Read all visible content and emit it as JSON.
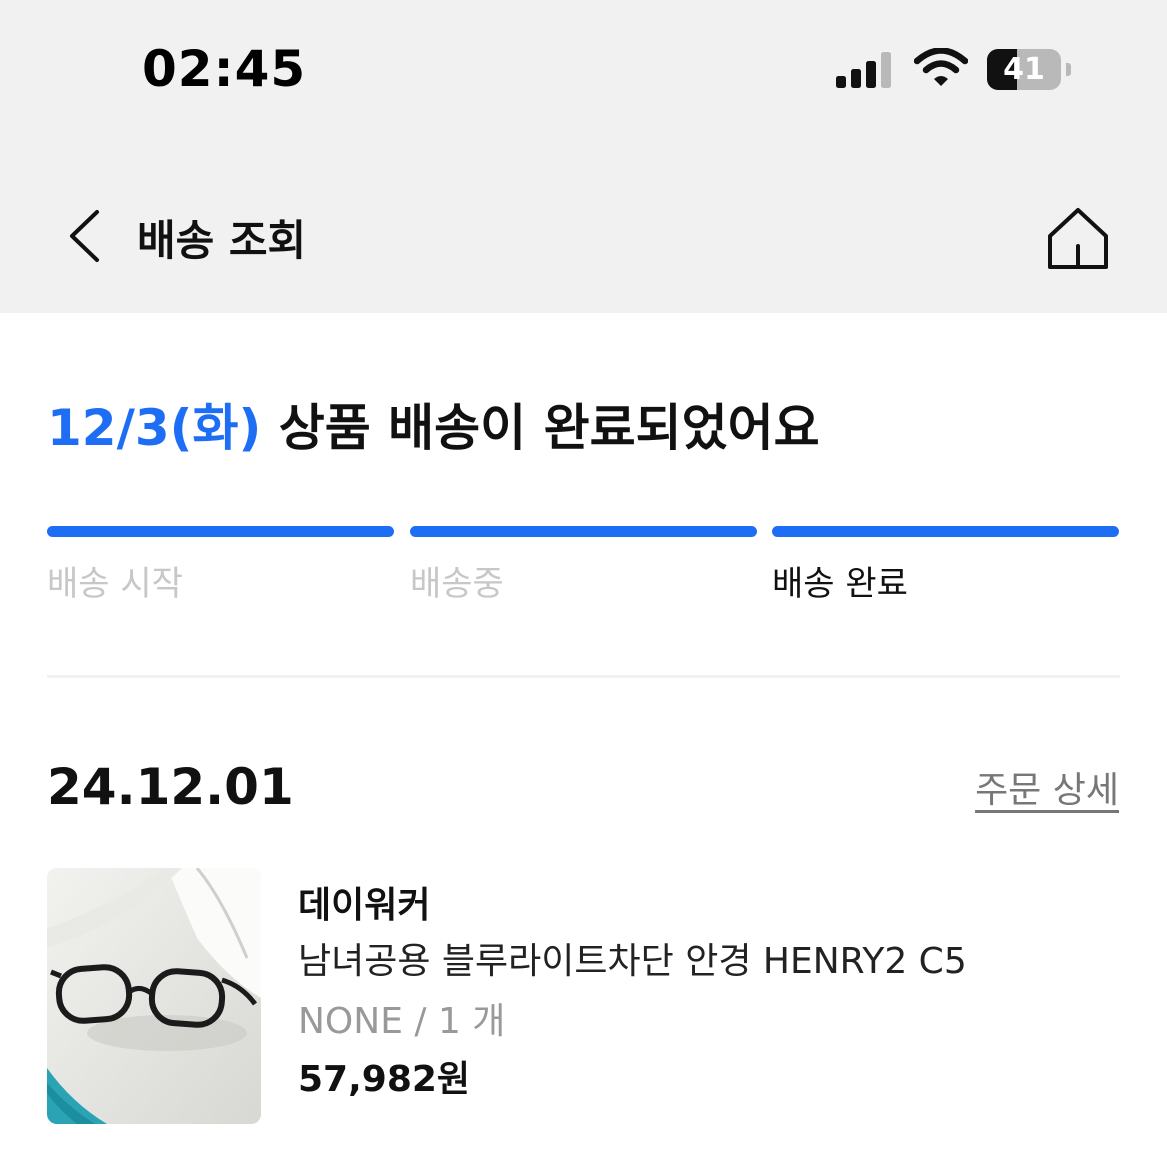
{
  "status_bar": {
    "time": "02:45",
    "battery_level": "41",
    "battery_fraction": 0.41,
    "icons": [
      "cellular-signal-icon",
      "wifi-icon",
      "battery-icon"
    ]
  },
  "nav": {
    "title": "배송 조회",
    "back_icon": "chevron-left-icon",
    "home_icon": "home-icon"
  },
  "delivery": {
    "date": "12/3(화)",
    "message": "상품 배송이 완료되었어요",
    "steps": [
      {
        "label": "배송 시작",
        "completed": true,
        "current": false
      },
      {
        "label": "배송중",
        "completed": true,
        "current": false
      },
      {
        "label": "배송 완료",
        "completed": true,
        "current": true
      }
    ]
  },
  "order": {
    "date": "24.12.01",
    "detail_link": "주문 상세",
    "item": {
      "brand": "데이워커",
      "name": "남녀공용 블루라이트차단 안경 HENRY2 C5",
      "option": "NONE / 1 개",
      "price": "57,982원"
    }
  },
  "colors": {
    "accent": "#1e6ef5",
    "header_bg": "#f1f1f1",
    "inactive_text": "#c7c7c7",
    "muted_text": "#999999"
  }
}
